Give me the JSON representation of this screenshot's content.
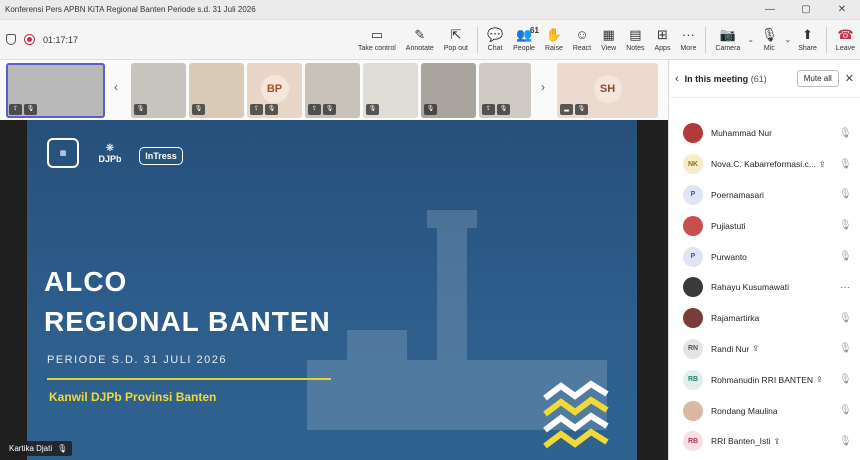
{
  "window": {
    "title": "Konferensi Pers APBN KiTA Regional Banten Periode s.d. 31 Juli 2026",
    "controls": [
      "—",
      "▢",
      "✕"
    ]
  },
  "meeting": {
    "timer": "01:17:17"
  },
  "toolbar": {
    "take_control": "Take control",
    "annotate": "Annotate",
    "pop_out": "Pop out",
    "chat": "Chat",
    "people": "People",
    "people_count": "61",
    "raise": "Raise",
    "react": "React",
    "view": "View",
    "notes": "Notes",
    "apps": "Apps",
    "more": "More",
    "camera": "Camera",
    "mic": "Mic",
    "share": "Share",
    "leave": "Leave"
  },
  "thumbnails": [
    {
      "initials": "",
      "bg": "#b9b9b9"
    },
    {
      "initials": "",
      "bg": "#c7c3bd"
    },
    {
      "initials": "",
      "bg": "#d9cbb8"
    },
    {
      "initials": "BP",
      "bg": "#e8d6c8",
      "fg": "#a0522d"
    },
    {
      "initials": "",
      "bg": "#c9c2bb"
    },
    {
      "initials": "",
      "bg": "#e0dcd6"
    },
    {
      "initials": "",
      "bg": "#a9a49d"
    },
    {
      "initials": "",
      "bg": "#cfcac4"
    },
    {
      "initials": "SH",
      "bg": "#ecd9cf",
      "fg": "#8a4a38"
    }
  ],
  "slide": {
    "title_line1": "ALCO",
    "title_line2": "REGIONAL BANTEN",
    "period": "PERIODE S.D. 31 JULI 2026",
    "office": "Kanwil DJPb Provinsi Banten",
    "logo_djpb": "DJPb",
    "logo_intress": "InTress"
  },
  "presenter": {
    "name": "Kartika Djati"
  },
  "panel": {
    "title": "In this meeting",
    "count": "(61)",
    "mute_all": "Mute all"
  },
  "participants": [
    {
      "name": "Muhammad Nur",
      "initials": "",
      "photo": true,
      "bg": "#b33a3a",
      "sharing": false,
      "status": "muted"
    },
    {
      "name": "Nova.C. Kabarreformasi.c...",
      "initials": "NK",
      "photo": false,
      "bg": "#f6edc7",
      "fg": "#8a6d1a",
      "sharing": true,
      "status": "muted"
    },
    {
      "name": "Poernamasari",
      "initials": "P",
      "photo": false,
      "bg": "#dfe5f5",
      "fg": "#3b5aa8",
      "sharing": false,
      "status": "muted"
    },
    {
      "name": "Pujiastuti",
      "initials": "",
      "photo": true,
      "bg": "#c94f4f",
      "sharing": false,
      "status": "muted"
    },
    {
      "name": "Purwanto",
      "initials": "P",
      "photo": false,
      "bg": "#dfe5f5",
      "fg": "#3b5aa8",
      "sharing": false,
      "status": "muted"
    },
    {
      "name": "Rahayu Kusumawati",
      "initials": "",
      "photo": true,
      "bg": "#3a3a3a",
      "sharing": false,
      "status": "more"
    },
    {
      "name": "Rajamartirka",
      "initials": "",
      "photo": true,
      "bg": "#7a3b3b",
      "sharing": false,
      "status": "muted"
    },
    {
      "name": "Randi Nur",
      "initials": "RN",
      "photo": false,
      "bg": "#e4e4e4",
      "fg": "#555555",
      "sharing": true,
      "status": "muted"
    },
    {
      "name": "Rohmanudin RRI BANTEN",
      "initials": "RB",
      "photo": false,
      "bg": "#dff0ec",
      "fg": "#2e7d6b",
      "sharing": true,
      "status": "muted"
    },
    {
      "name": "Rondang Maulina",
      "initials": "",
      "photo": true,
      "bg": "#d9b9a3",
      "sharing": false,
      "status": "muted"
    },
    {
      "name": "RRI Banten_Isti",
      "initials": "RB",
      "photo": false,
      "bg": "#f7dfe4",
      "fg": "#a33b57",
      "sharing": true,
      "status": "muted"
    }
  ]
}
